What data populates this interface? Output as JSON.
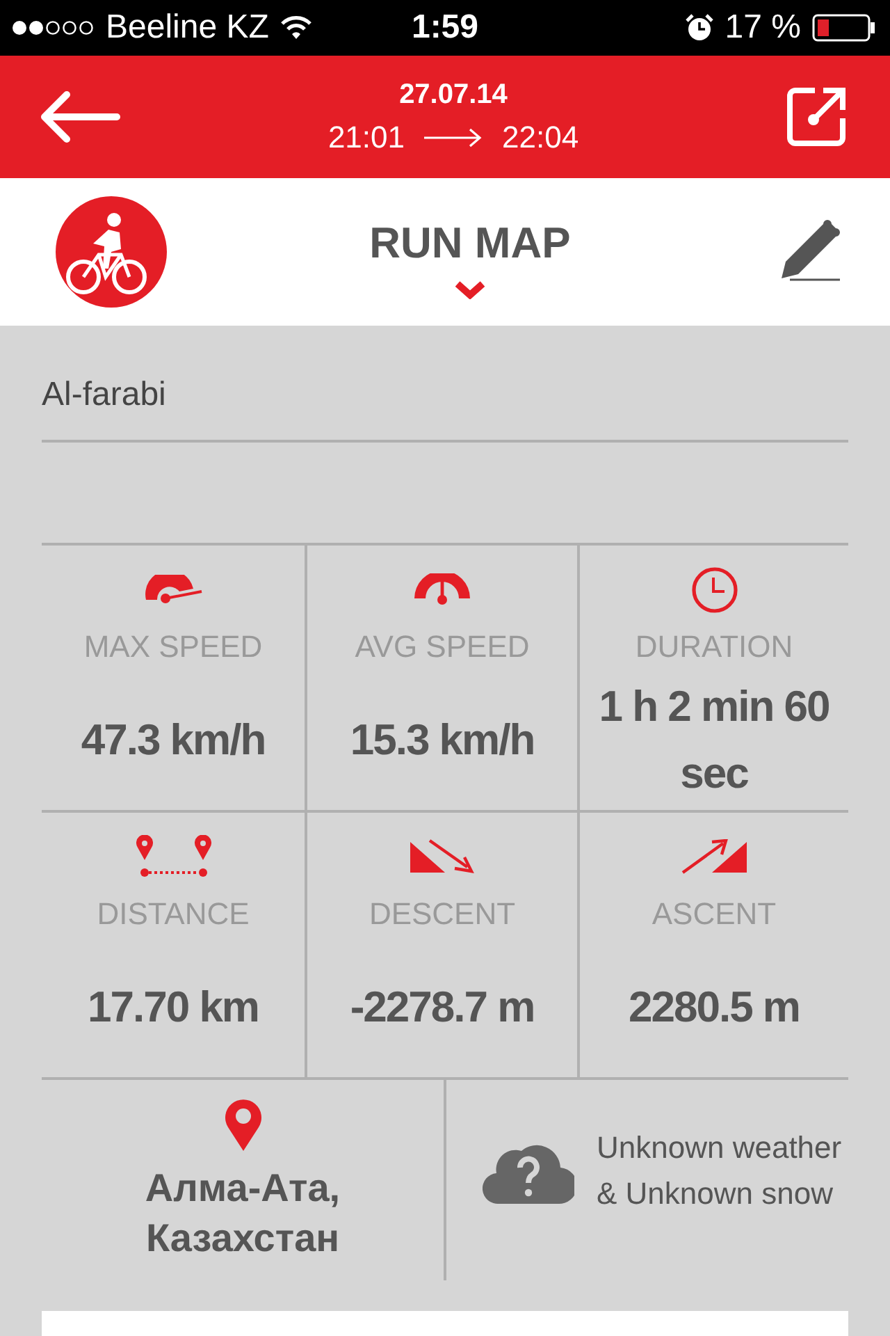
{
  "status_bar": {
    "carrier": "Beeline KZ",
    "time": "1:59",
    "battery": "17 %"
  },
  "header": {
    "date": "27.07.14",
    "start": "21:01",
    "end": "22:04"
  },
  "title_bar": {
    "title": "RUN MAP"
  },
  "route_name": "Al-farabi",
  "stats": [
    {
      "kind": "max_speed",
      "label": "MAX SPEED",
      "value": "47.3 km/h"
    },
    {
      "kind": "avg_speed",
      "label": "AVG SPEED",
      "value": "15.3 km/h"
    },
    {
      "kind": "duration",
      "label": "DURATION",
      "value": "1 h 2 min 60 sec"
    },
    {
      "kind": "distance",
      "label": "DISTANCE",
      "value": "17.70 km"
    },
    {
      "kind": "descent",
      "label": "DESCENT",
      "value": "-2278.7 m"
    },
    {
      "kind": "ascent",
      "label": "ASCENT",
      "value": "2280.5 m"
    }
  ],
  "location": "Алма-Ата, Казахстан",
  "weather": "Unknown weather & Unknown snow"
}
